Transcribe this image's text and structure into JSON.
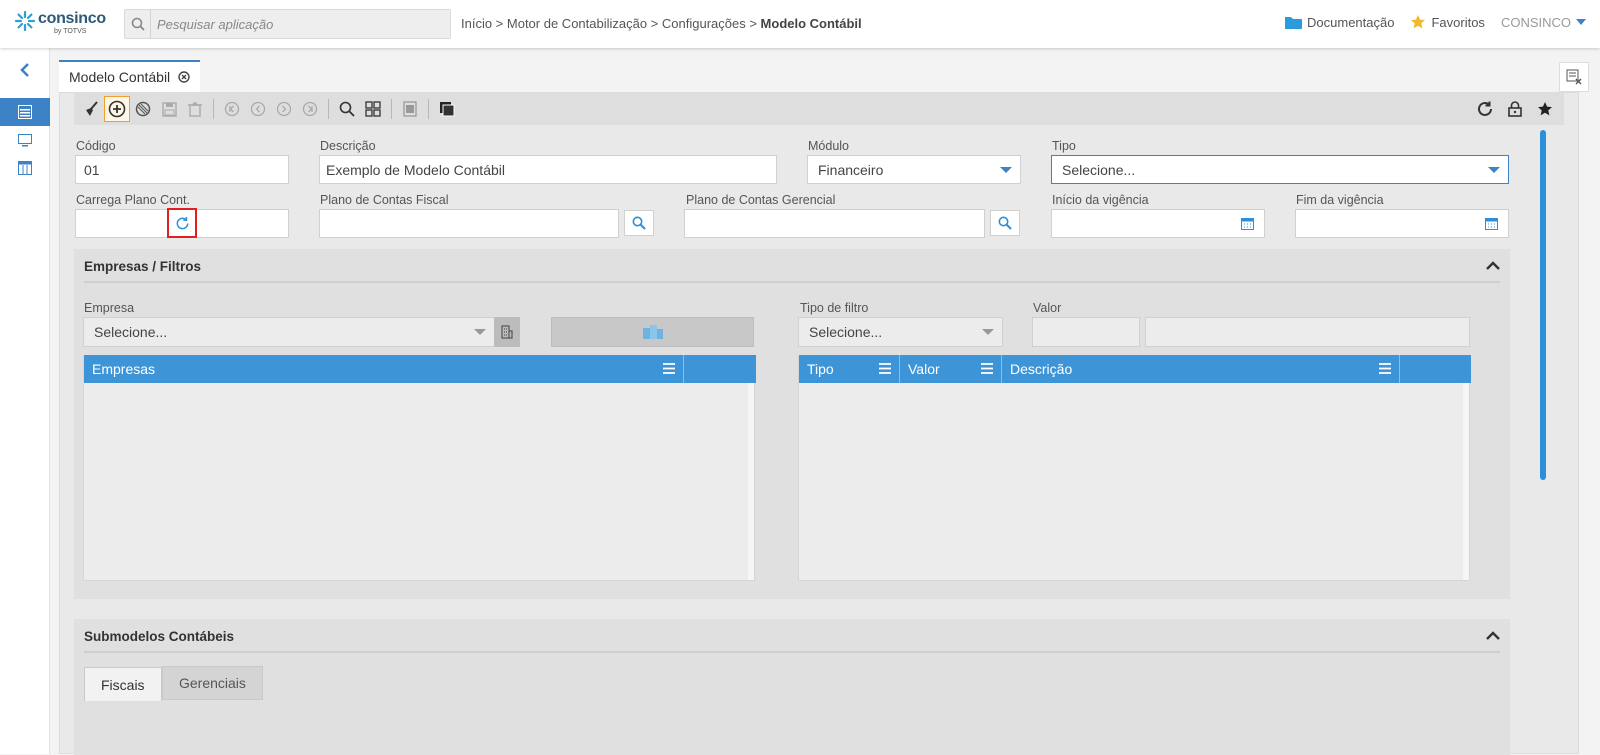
{
  "brand": {
    "name": "consinco",
    "sub": "by TOTVS",
    "accent": "#3d82c4"
  },
  "search": {
    "placeholder": "Pesquisar aplicação"
  },
  "breadcrumb": {
    "path": "Início > Motor de Contabilização > Configurações > ",
    "current": "Modelo Contábil"
  },
  "topnav": {
    "docs": "Documentação",
    "favorites": "Favoritos",
    "user": "CONSINCO"
  },
  "tab": {
    "title": "Modelo Contábil"
  },
  "form": {
    "codigo_label": "Código",
    "codigo_value": "01",
    "descricao_label": "Descrição",
    "descricao_value": "Exemplo de Modelo Contábil",
    "modulo_label": "Módulo",
    "modulo_value": "Financeiro",
    "tipo_label": "Tipo",
    "tipo_value": "Selecione...",
    "carrega_label": "Carrega Plano Cont.",
    "plano_fiscal_label": "Plano de Contas Fiscal",
    "plano_gerencial_label": "Plano de Contas Gerencial",
    "inicio_label": "Início da vigência",
    "fim_label": "Fim da vigência"
  },
  "empresas_section": {
    "title": "Empresas / Filtros",
    "empresa_label": "Empresa",
    "empresa_value": "Selecione...",
    "tipo_filtro_label": "Tipo de filtro",
    "tipo_filtro_value": "Selecione...",
    "valor_label": "Valor",
    "grid_left_headers": [
      "Empresas",
      ""
    ],
    "grid_right_headers": [
      "Tipo",
      "Valor",
      "Descrição",
      ""
    ]
  },
  "submodelos_section": {
    "title": "Submodelos Contábeis",
    "tabs": [
      "Fiscais",
      "Gerenciais"
    ]
  }
}
